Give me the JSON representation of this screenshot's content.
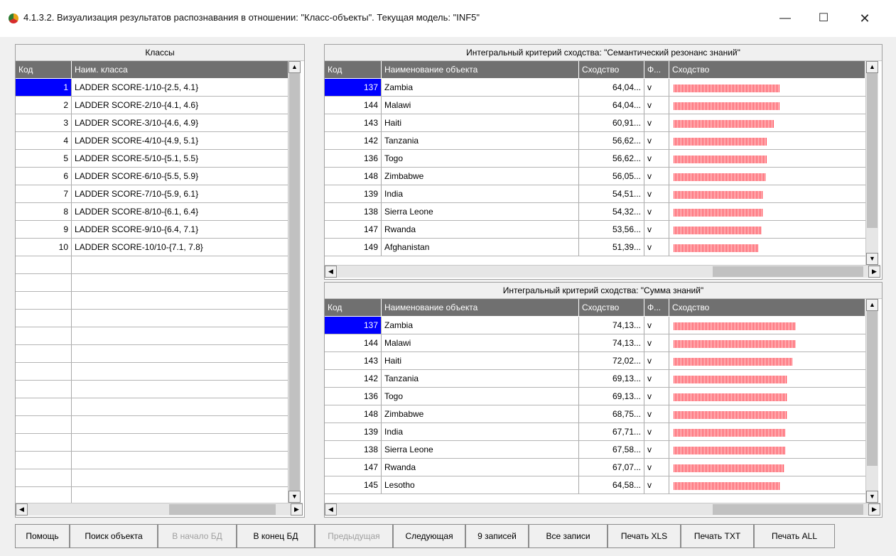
{
  "window": {
    "title": "4.1.3.2. Визуализация результатов распознавания в отношении: \"Класс-объекты\". Текущая модель: \"INF5\"",
    "controls": {
      "minimize": "—",
      "maximize": "☐",
      "close": "✕"
    }
  },
  "classes_panel": {
    "title": "Классы",
    "headers": {
      "code": "Код",
      "name": "Наим. класса"
    },
    "rows": [
      {
        "code": "1",
        "name": "LADDER SCORE-1/10-{2.5, 4.1}"
      },
      {
        "code": "2",
        "name": "LADDER SCORE-2/10-{4.1, 4.6}"
      },
      {
        "code": "3",
        "name": "LADDER SCORE-3/10-{4.6, 4.9}"
      },
      {
        "code": "4",
        "name": "LADDER SCORE-4/10-{4.9, 5.1}"
      },
      {
        "code": "5",
        "name": "LADDER SCORE-5/10-{5.1, 5.5}"
      },
      {
        "code": "6",
        "name": "LADDER SCORE-6/10-{5.5, 5.9}"
      },
      {
        "code": "7",
        "name": "LADDER SCORE-7/10-{5.9, 6.1}"
      },
      {
        "code": "8",
        "name": "LADDER SCORE-8/10-{6.1, 6.4}"
      },
      {
        "code": "9",
        "name": "LADDER SCORE-9/10-{6.4, 7.1}"
      },
      {
        "code": "10",
        "name": "LADDER SCORE-10/10-{7.1, 7.8}"
      }
    ]
  },
  "semantic_panel": {
    "title": "Интегральный критерий сходства: \"Семантический резонанс знаний\"",
    "headers": {
      "code": "Код",
      "name": "Наименование объекта",
      "similarity": "Сходство",
      "fact": "Ф...",
      "bar": "Сходство"
    },
    "rows": [
      {
        "code": "137",
        "name": "Zambia",
        "similarity": "64,04...",
        "fact": "v",
        "fill": 0.6404
      },
      {
        "code": "144",
        "name": "Malawi",
        "similarity": "64,04...",
        "fact": "v",
        "fill": 0.6404
      },
      {
        "code": "143",
        "name": "Haiti",
        "similarity": "60,91...",
        "fact": "v",
        "fill": 0.6091
      },
      {
        "code": "142",
        "name": "Tanzania",
        "similarity": "56,62...",
        "fact": "v",
        "fill": 0.5662
      },
      {
        "code": "136",
        "name": "Togo",
        "similarity": "56,62...",
        "fact": "v",
        "fill": 0.5662
      },
      {
        "code": "148",
        "name": "Zimbabwe",
        "similarity": "56,05...",
        "fact": "v",
        "fill": 0.5605
      },
      {
        "code": "139",
        "name": "India",
        "similarity": "54,51...",
        "fact": "v",
        "fill": 0.5451
      },
      {
        "code": "138",
        "name": "Sierra Leone",
        "similarity": "54,32...",
        "fact": "v",
        "fill": 0.5432
      },
      {
        "code": "147",
        "name": "Rwanda",
        "similarity": "53,56...",
        "fact": "v",
        "fill": 0.5356
      },
      {
        "code": "149",
        "name": "Afghanistan",
        "similarity": "51,39...",
        "fact": "v",
        "fill": 0.5139
      }
    ]
  },
  "sum_panel": {
    "title": "Интегральный критерий сходства: \"Сумма знаний\"",
    "headers": {
      "code": "Код",
      "name": "Наименование объекта",
      "similarity": "Сходство",
      "fact": "Ф...",
      "bar": "Сходство"
    },
    "rows": [
      {
        "code": "137",
        "name": "Zambia",
        "similarity": "74,13...",
        "fact": "v",
        "fill": 0.7413
      },
      {
        "code": "144",
        "name": "Malawi",
        "similarity": "74,13...",
        "fact": "v",
        "fill": 0.7413
      },
      {
        "code": "143",
        "name": "Haiti",
        "similarity": "72,02...",
        "fact": "v",
        "fill": 0.7202
      },
      {
        "code": "142",
        "name": "Tanzania",
        "similarity": "69,13...",
        "fact": "v",
        "fill": 0.6913
      },
      {
        "code": "136",
        "name": "Togo",
        "similarity": "69,13...",
        "fact": "v",
        "fill": 0.6913
      },
      {
        "code": "148",
        "name": "Zimbabwe",
        "similarity": "68,75...",
        "fact": "v",
        "fill": 0.6875
      },
      {
        "code": "139",
        "name": "India",
        "similarity": "67,71...",
        "fact": "v",
        "fill": 0.6771
      },
      {
        "code": "138",
        "name": "Sierra Leone",
        "similarity": "67,58...",
        "fact": "v",
        "fill": 0.6758
      },
      {
        "code": "147",
        "name": "Rwanda",
        "similarity": "67,07...",
        "fact": "v",
        "fill": 0.6707
      },
      {
        "code": "145",
        "name": "Lesotho",
        "similarity": "64,58...",
        "fact": "v",
        "fill": 0.6458
      }
    ]
  },
  "buttons": [
    {
      "label": "Помощь",
      "name": "help-button",
      "enabled": true
    },
    {
      "label": "Поиск объекта",
      "name": "find-object-button",
      "enabled": true
    },
    {
      "label": "В начало БД",
      "name": "db-start-button",
      "enabled": false
    },
    {
      "label": "В конец БД",
      "name": "db-end-button",
      "enabled": true
    },
    {
      "label": "Предыдущая",
      "name": "previous-button",
      "enabled": false
    },
    {
      "label": "Следующая",
      "name": "next-button",
      "enabled": true
    },
    {
      "label": "9 записей",
      "name": "nine-records-button",
      "enabled": true
    },
    {
      "label": "Все записи",
      "name": "all-records-button",
      "enabled": true
    },
    {
      "label": "Печать XLS",
      "name": "print-xls-button",
      "enabled": true
    },
    {
      "label": "Печать TXT",
      "name": "print-txt-button",
      "enabled": true
    },
    {
      "label": "Печать ALL",
      "name": "print-all-button",
      "enabled": true
    }
  ],
  "colors": {
    "selection": "#0000ff",
    "header": "#707070",
    "bar": "#ff4d5a"
  }
}
